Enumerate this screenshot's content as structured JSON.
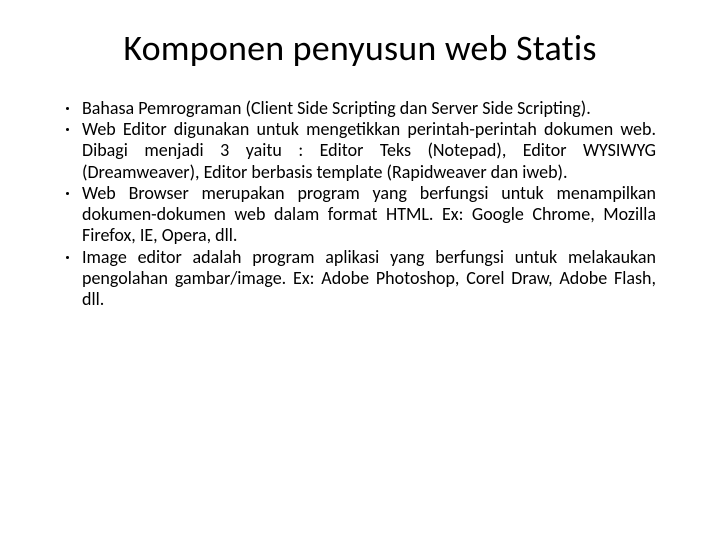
{
  "title": "Komponen penyusun web Statis",
  "bullets": [
    "Bahasa Pemrograman (Client Side Scripting dan Server Side Scripting).",
    "Web Editor digunakan untuk mengetikkan perintah-perintah dokumen web. Dibagi menjadi 3 yaitu : Editor Teks (Notepad), Editor WYSIWYG (Dreamweaver), Editor berbasis template (Rapidweaver dan iweb).",
    "Web Browser merupakan program yang berfungsi untuk menampilkan dokumen-dokumen web dalam format HTML. Ex: Google Chrome, Mozilla Firefox, IE, Opera, dll.",
    "Image editor adalah program aplikasi yang berfungsi untuk melakaukan pengolahan gambar/image. Ex: Adobe Photoshop, Corel Draw,  Adobe Flash, dll."
  ]
}
